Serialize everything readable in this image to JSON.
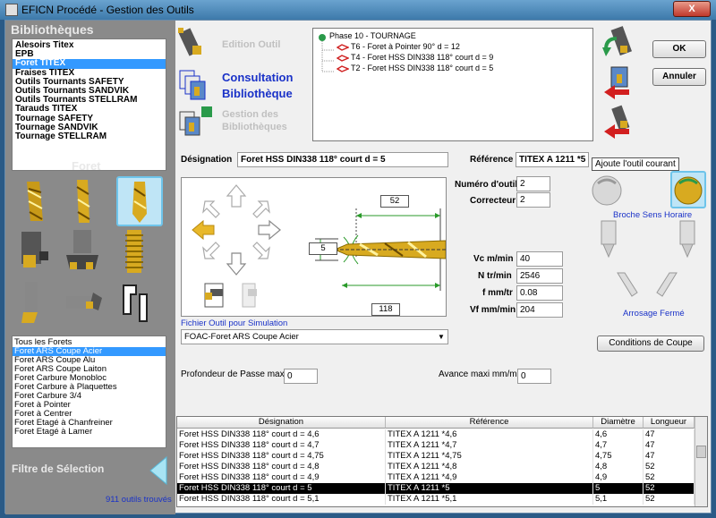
{
  "window": {
    "title": "EFICN Procédé - Gestion des Outils",
    "close": "X"
  },
  "left": {
    "bibliotheques_title": "Bibliothèques",
    "libraries": [
      "Alesoirs Titex",
      "EPB",
      "Foret TITEX",
      "Fraises TITEX",
      "Outils Tournants SAFETY",
      "Outils Tournants SANDVIK",
      "Outils Tournants STELLRAM",
      "Tarauds TITEX",
      "Tournage  SAFETY",
      "Tournage SANDVIK",
      "Tournage STELLRAM"
    ],
    "selected_library": 2,
    "family_title": "Foret",
    "families": [
      "Tous les Forets",
      "Foret ARS Coupe Acier",
      "Foret ARS Coupe Alu",
      "Foret ARS Coupe Laiton",
      "Foret Carbure Monobloc",
      "Foret Carbure à Plaquettes",
      "Foret Carbure 3/4",
      "Foret à Pointer",
      "Foret à Centrer",
      "Foret Etagé à Chanfreiner",
      "Foret Etagé à Lamer"
    ],
    "selected_family": 1,
    "filtre_title": "Filtre de Sélection",
    "count": "911 outils trouvés"
  },
  "menu": {
    "edition": "Edition Outil",
    "consultation_1": "Consultation",
    "consultation_2": "Bibliothèque",
    "gestion_1": "Gestion des",
    "gestion_2": "Bibliothèques"
  },
  "tree": {
    "phase": "Phase 10 - TOURNAGE",
    "items": [
      "T6 - Foret à Pointer 90° d = 12",
      "T4 - Foret HSS DIN338 118° court d = 9",
      "T2 - Foret HSS DIN338 118° court d = 5"
    ]
  },
  "buttons": {
    "ok": "OK",
    "annuler": "Annuler",
    "conditions": "Conditions de Coupe"
  },
  "tooltip": "Ajoute l'outil courant",
  "form": {
    "designation_label": "Désignation",
    "designation": "Foret HSS DIN338 118° court d = 5",
    "reference_label": "Référence",
    "reference": "TITEX A 1211 *5",
    "numero_label": "Numéro d'outil",
    "numero": "2",
    "correcteur_label": "Correcteur",
    "correcteur": "2",
    "vc_label": "Vc m/min",
    "vc": "40",
    "n_label": "N tr/min",
    "n": "2546",
    "f_label": "f mm/tr",
    "f": "0.08",
    "vf_label": "Vf mm/min",
    "vf": "204",
    "fichier_label": "Fichier Outil pour Simulation",
    "fichier": "FOAC-Foret ARS Coupe Acier",
    "profondeur_label": "Profondeur de Passe maxi",
    "profondeur": "0",
    "avance_label": "Avance maxi mm/min",
    "avance": "0",
    "broche": "Broche Sens Horaire",
    "arrosage": "Arrosage Fermé"
  },
  "drawing": {
    "dim_top": "52",
    "dim_left": "5",
    "dim_bottom": "118"
  },
  "table": {
    "headers": [
      "Désignation",
      "Référence",
      "Diamètre",
      "Longueur"
    ],
    "rows": [
      [
        "Foret HSS DIN338 118° court d = 4,6",
        "TITEX A 1211 *4,6",
        "4,6",
        "47"
      ],
      [
        "Foret HSS DIN338 118° court d = 4,7",
        "TITEX A 1211 *4,7",
        "4,7",
        "47"
      ],
      [
        "Foret HSS DIN338 118° court d = 4,75",
        "TITEX A 1211 *4,75",
        "4,75",
        "47"
      ],
      [
        "Foret HSS DIN338 118° court d = 4,8",
        "TITEX A 1211 *4,8",
        "4,8",
        "52"
      ],
      [
        "Foret HSS DIN338 118° court d = 4,9",
        "TITEX A 1211 *4,9",
        "4,9",
        "52"
      ],
      [
        "Foret HSS DIN338 118° court d = 5",
        "TITEX A 1211 *5",
        "5",
        "52"
      ],
      [
        "Foret HSS DIN338 118° court d = 5,1",
        "TITEX A 1211 *5,1",
        "5,1",
        "52"
      ]
    ],
    "selected_row": 5
  }
}
